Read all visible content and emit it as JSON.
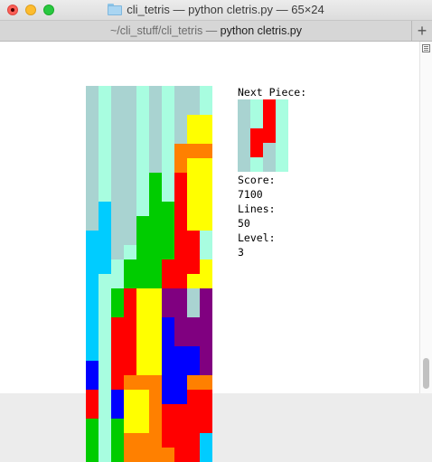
{
  "window": {
    "title": "cli_tetris — python cletris.py — 65×24",
    "tab_path": "~/cli_stuff/cli_tetris — ",
    "tab_process": "python cletris.py",
    "new_tab_symbol": "+"
  },
  "game": {
    "next_piece_label": "Next Piece:",
    "score_label": "Score:",
    "score": "7100",
    "lines_label": "Lines:",
    "lines": "50",
    "level_label": "Level:",
    "level": "3"
  },
  "colors": {
    "A": "#a9d3d1",
    "B": "#a8fde0",
    "Y": "#ffff00",
    "O": "#ff8000",
    "G": "#00cc00",
    "R": "#ff0000",
    "C": "#00ccff",
    "P": "#800080",
    "N": "#0000ff",
    "W": "#ffffff"
  },
  "board": [
    "ABAABABAAB",
    "ABAABABAAB",
    "ABAABABAYY",
    "ABAABABAYY",
    "ABAABABOOO",
    "ABAABABOYY",
    "ABAABGBRYY",
    "ABAABGBRYY",
    "ACAABGGRYY",
    "ACAAGGGRYY",
    "CCAAGGGRRB",
    "CCABGGGRRB",
    "CCBGGGRRRY",
    "CBBGGGRRYY",
    "CBGRYYPPAP",
    "CBGRYYPPAP",
    "CBRRYYNPPP",
    "CBRRYYNPPP",
    "CBRRYYNNNP",
    "NBRRYYNNNP",
    "NBROOONNOO",
    "RBNYYONNRR",
    "RBNYYORRRR",
    "GBGYYORRRR",
    "GBGOOORRRC",
    "GBGOOOORRC"
  ],
  "next_piece": [
    "ABRB",
    "ABRB",
    "ARRB",
    "ARAB",
    "ABAB"
  ]
}
